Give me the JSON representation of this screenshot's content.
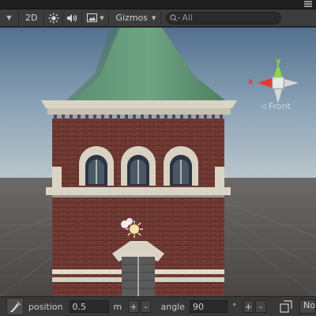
{
  "toolbar": {
    "view_mode_label": "2D",
    "gizmos_label": "Gizmos",
    "search_placeholder": "All"
  },
  "orientation_gizmo": {
    "axis_x_label": "x",
    "axis_y_label": "y",
    "view_label": "Front",
    "colors": {
      "x": "#e33b2e",
      "y": "#8fd83c",
      "z": "#4aa3ff"
    }
  },
  "bottom_bar": {
    "position_label": "position",
    "position_value": "0.5",
    "position_unit": "m",
    "angle_label": "angle",
    "angle_value": "90",
    "angle_unit": "°",
    "plus_label": "+",
    "minus_label": "-",
    "trailing_label": "No"
  }
}
